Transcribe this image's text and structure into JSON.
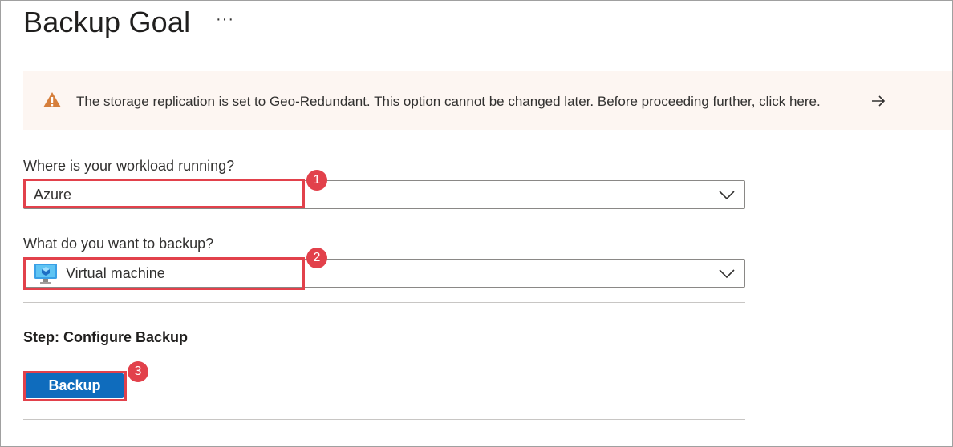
{
  "page": {
    "title": "Backup Goal",
    "more_label": "···"
  },
  "banner": {
    "icon": "warning-icon",
    "text": "The storage replication is set to Geo-Redundant. This option cannot be changed later. Before proceeding further, click here.",
    "arrow_icon": "arrow-right-icon",
    "background": "#fdf6f2",
    "icon_color": "#d67f3c"
  },
  "workload": {
    "label": "Where is your workload running?",
    "value": "Azure",
    "step": "1"
  },
  "backup_type": {
    "label": "What do you want to backup?",
    "value": "Virtual machine",
    "icon": "virtual-machine-icon",
    "step": "2"
  },
  "configure": {
    "title": "Step: Configure Backup",
    "button_label": "Backup",
    "step": "3"
  },
  "colors": {
    "accent": "#0f6cbd",
    "highlight": "#e2414b"
  }
}
